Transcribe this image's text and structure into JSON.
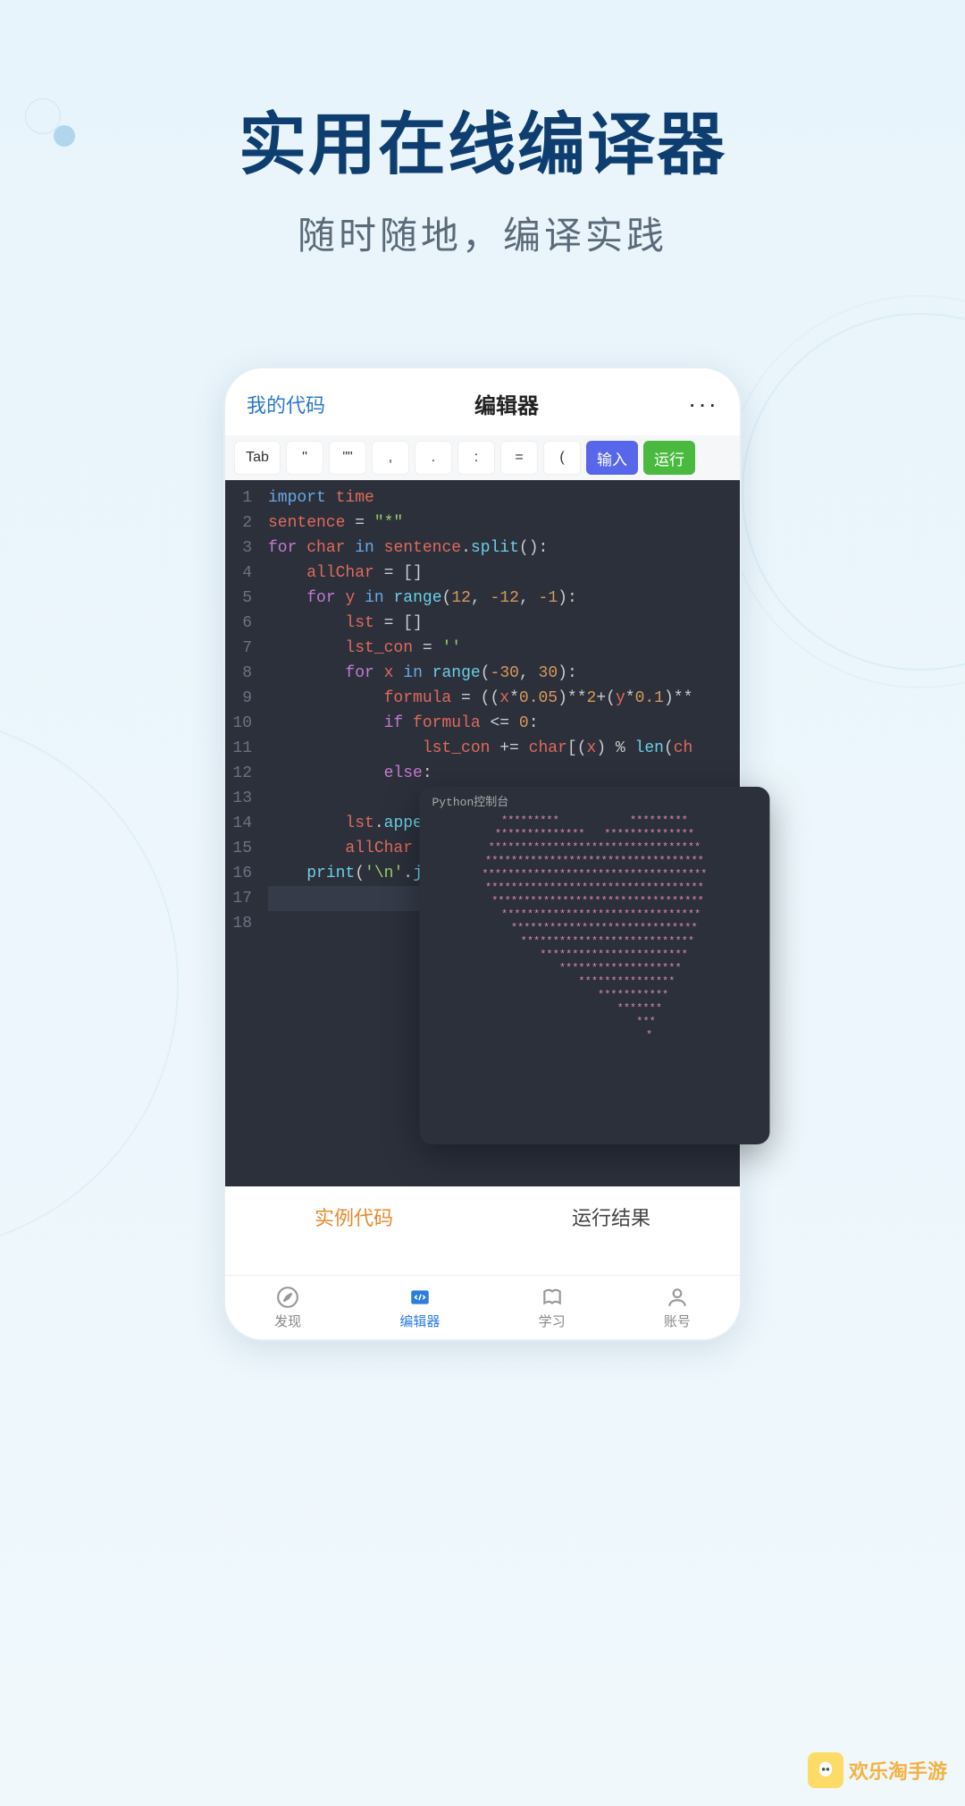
{
  "hero": {
    "title": "实用在线编译器",
    "subtitle": "随时随地，编译实践"
  },
  "header": {
    "left": "我的代码",
    "title": "编辑器",
    "more": "···"
  },
  "toolbar": {
    "keys": [
      "Tab",
      "''",
      "\"\"",
      ",",
      ".",
      ":",
      "=",
      "("
    ],
    "input_label": "输入",
    "run_label": "运行"
  },
  "code": {
    "lines": [
      {
        "n": "1",
        "html": "<span class='imp'>import</span> <span class='id'>time</span>"
      },
      {
        "n": "2",
        "html": "<span class='id'>sentence</span> = <span class='str'>\"*\"</span>"
      },
      {
        "n": "3",
        "html": "<span class='kw'>for</span> <span class='id'>char</span> <span class='imp'>in</span> <span class='id'>sentence</span>.<span class='fn'>split</span>():"
      },
      {
        "n": "4",
        "html": "    <span class='id'>allChar</span> = []"
      },
      {
        "n": "5",
        "html": "    <span class='kw'>for</span> <span class='id'>y</span> <span class='imp'>in</span> <span class='fn'>range</span>(<span class='num'>12</span>, <span class='num'>-12</span>, <span class='num'>-1</span>):"
      },
      {
        "n": "6",
        "html": "        <span class='id'>lst</span> = []"
      },
      {
        "n": "7",
        "html": "        <span class='id'>lst_con</span> = <span class='str'>''</span>"
      },
      {
        "n": "8",
        "html": "        <span class='kw'>for</span> <span class='id'>x</span> <span class='imp'>in</span> <span class='fn'>range</span>(<span class='num'>-30</span>, <span class='num'>30</span>):"
      },
      {
        "n": "9",
        "html": "            <span class='id'>formula</span> = ((<span class='id'>x</span>*<span class='num'>0.05</span>)**<span class='num'>2</span>+(<span class='id'>y</span>*<span class='num'>0.1</span>)**"
      },
      {
        "n": "10",
        "html": "            <span class='kw'>if</span> <span class='id'>formula</span> &lt;= <span class='num'>0</span>:"
      },
      {
        "n": "11",
        "html": "                <span class='id'>lst_con</span> += <span class='id'>char</span>[(<span class='id'>x</span>) % <span class='fn'>len</span>(<span class='id'>ch</span>"
      },
      {
        "n": "12",
        "html": "            <span class='kw'>else</span>:"
      },
      {
        "n": "13",
        "html": " "
      },
      {
        "n": "14",
        "html": "        <span class='id'>lst</span>.<span class='fn'>appe</span>"
      },
      {
        "n": "15",
        "html": "        <span class='id'>allChar</span>"
      },
      {
        "n": "16",
        "html": "    <span class='fn'>print</span>(<span class='str'>'\\n'</span>.<span class='fn'>j</span>"
      },
      {
        "n": "17",
        "html": " "
      },
      {
        "n": "18",
        "html": " "
      }
    ]
  },
  "bottom_tabs": {
    "example": "实例代码",
    "result": "运行结果"
  },
  "nav": {
    "items": [
      {
        "label": "发现",
        "icon": "compass"
      },
      {
        "label": "编辑器",
        "icon": "code"
      },
      {
        "label": "学习",
        "icon": "book"
      },
      {
        "label": "账号",
        "icon": "person"
      }
    ],
    "active_index": 1
  },
  "console": {
    "title": "Python控制台",
    "heart": [
      "*********           *********",
      "**************   **************",
      "*********************************",
      "**********************************",
      "***********************************",
      "**********************************",
      " *********************************",
      "  *******************************",
      "   *****************************",
      "    ***************************",
      "      ***********************",
      "        *******************",
      "          ***************",
      "            ***********",
      "              *******",
      "                ***",
      "                 *"
    ]
  },
  "watermark": {
    "text": "欢乐淘手游"
  }
}
